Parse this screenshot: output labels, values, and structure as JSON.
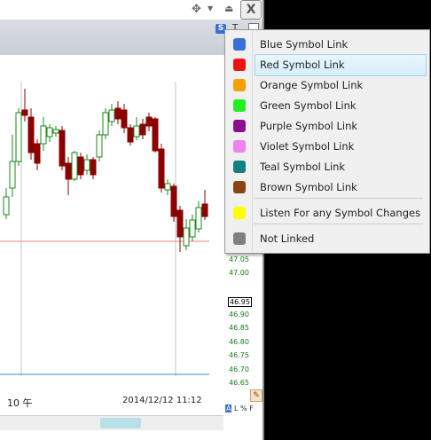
{
  "window": {
    "close_glyph": "X",
    "move_icon": "move-icon",
    "symbol_link_badge": "S",
    "text_tool_label": "T",
    "colors": {
      "up_candle": "#1a8a1a",
      "down_candle": "#8b0000",
      "hline_red": "#f08080",
      "hline_blue": "#3a8fbf"
    }
  },
  "chart": {
    "x_labels": [
      "10 午",
      "2014/12/12 11:12"
    ],
    "y_ticks": [
      "47.05",
      "47.00",
      "46.90",
      "46.85",
      "46.80",
      "46.75",
      "46.70",
      "46.65"
    ],
    "last_price": "46.95"
  },
  "bottom_bar": {
    "a_label": "A",
    "l_label": "L",
    "pct_label": "%",
    "f_label": "F"
  },
  "menu": {
    "items": [
      {
        "label": "Blue Symbol Link",
        "color": "#3b6fd8"
      },
      {
        "label": "Red Symbol Link",
        "color": "#ee1111",
        "selected": true
      },
      {
        "label": "Orange Symbol Link",
        "color": "#f5a000"
      },
      {
        "label": "Green Symbol Link",
        "color": "#22ee22"
      },
      {
        "label": "Purple Symbol Link",
        "color": "#8a1090"
      },
      {
        "label": "Violet Symbol Link",
        "color": "#ee82ee"
      },
      {
        "label": "Teal Symbol Link",
        "color": "#118080"
      },
      {
        "label": "Brown Symbol Link",
        "color": "#8b4513"
      }
    ],
    "listen": {
      "label": "Listen For any Symbol Changes",
      "color": "#ffff00"
    },
    "not_linked": {
      "label": "Not Linked",
      "color": "#808080"
    }
  }
}
